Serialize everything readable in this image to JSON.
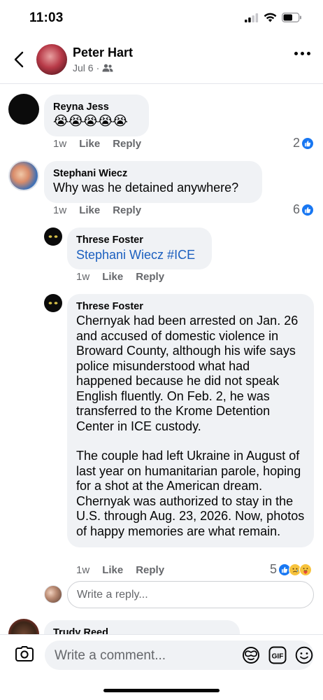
{
  "status": {
    "time": "11:03"
  },
  "header": {
    "name": "Peter Hart",
    "date": "Jul 6",
    "separator": "·"
  },
  "comments": [
    {
      "name": "Reyna Jess",
      "text": "😭😭😭😭😭",
      "time": "1w",
      "like": "Like",
      "reply": "Reply",
      "reaction_count": "2"
    },
    {
      "name": "Stephani Wiecz",
      "text": "Why was he detained anywhere?",
      "time": "1w",
      "like": "Like",
      "reply": "Reply",
      "reaction_count": "6"
    },
    {
      "name": "Threse Foster",
      "text": "Stephani Wiecz #ICE",
      "time": "1w",
      "like": "Like",
      "reply": "Reply"
    },
    {
      "name": "Threse Foster",
      "text_p1": "Chernyak had been arrested on Jan. 26 and accused of domestic violence in Broward County, although his wife says police misunderstood what had happened because he did not speak English fluently. On Feb. 2, he was transferred to the Krome Detention Center in ICE custody.",
      "text_p2": "The couple had left Ukraine in August of last year on humanitarian parole, hoping for a shot at the American dream. Chernyak was authorized to stay in the U.S. through Aug. 23, 2026. Now, photos of happy memories are what remain.",
      "time": "1w",
      "like": "Like",
      "reply": "Reply",
      "reaction_count": "5"
    },
    {
      "name": "Trudy Reed"
    }
  ],
  "reply_box": {
    "placeholder": "Write a reply..."
  },
  "composer": {
    "placeholder": "Write a comment..."
  },
  "icons": {
    "back": "chevron-left-icon",
    "more": "more-icon",
    "friends": "friends-audience-icon",
    "like": "like-thumb-icon",
    "camera": "camera-icon",
    "avatar_frame": "avatar-frame-icon",
    "gif": "gif-icon",
    "emoji": "emoji-icon"
  },
  "colors": {
    "link": "#1b5fbf",
    "like_blue": "#1877f2",
    "bubble": "#f0f2f5"
  }
}
